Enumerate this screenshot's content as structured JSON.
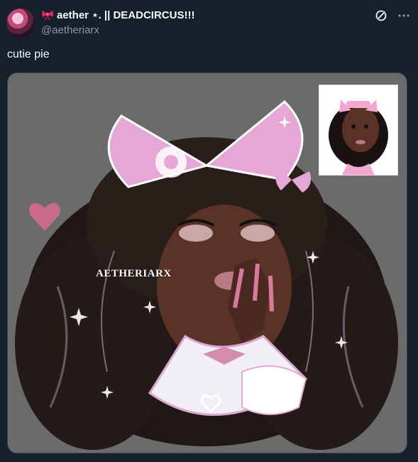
{
  "post": {
    "author": {
      "display_name": "aether ⋆. || DEADCIRCUS!!!",
      "handle": "@aetheriarx"
    },
    "text": "cutie pie",
    "media": {
      "watermark": "AETHERIARX"
    },
    "icons": {
      "badge": "bow-icon",
      "grok": "grok-icon",
      "more": "more-icon"
    }
  },
  "colors": {
    "background": "#15202b",
    "text_primary": "#f7f9f9",
    "text_secondary": "#8b98a5",
    "media_bg": "#6b6b6b",
    "accent_pink": "#e4a7d6"
  }
}
